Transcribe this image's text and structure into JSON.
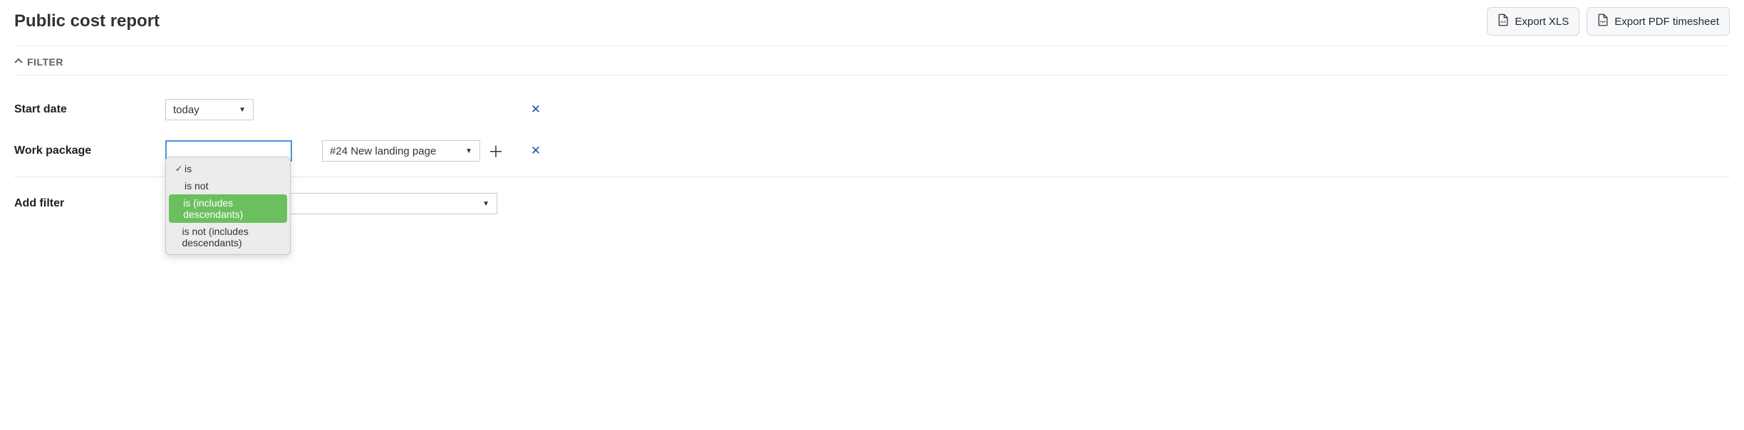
{
  "header": {
    "title": "Public cost report",
    "export_xls": "Export XLS",
    "export_pdf": "Export PDF timesheet"
  },
  "filter_section": {
    "label": "FILTER"
  },
  "filters": {
    "start_date": {
      "label": "Start date",
      "operator": "today"
    },
    "work_package": {
      "label": "Work package",
      "operator": "",
      "value": "#24 New landing page",
      "options": [
        {
          "label": "is",
          "selected": true,
          "highlight": false
        },
        {
          "label": "is not",
          "selected": false,
          "highlight": false
        },
        {
          "label": "is (includes descendants)",
          "selected": false,
          "highlight": true
        },
        {
          "label": "is not (includes descendants)",
          "selected": false,
          "highlight": false
        }
      ]
    }
  },
  "add_filter": {
    "label": "Add filter",
    "value": ""
  }
}
